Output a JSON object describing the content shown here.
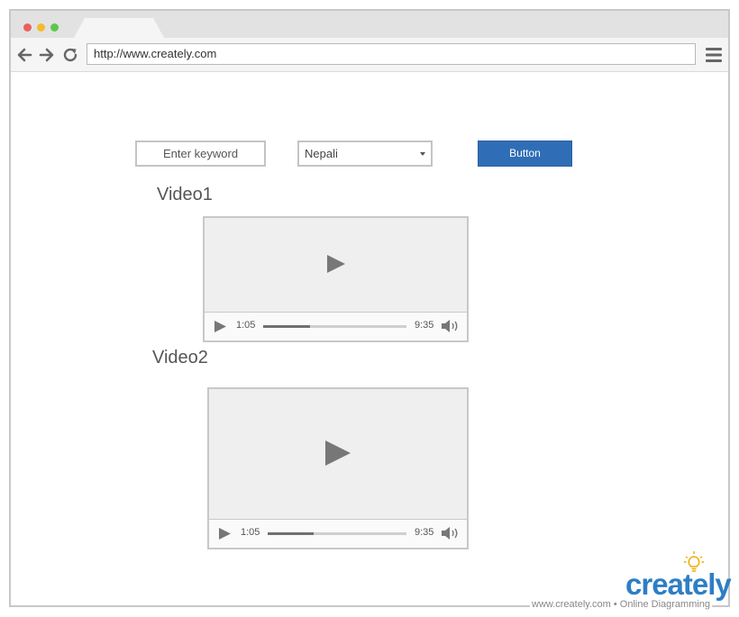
{
  "browser": {
    "url": "http://www.creately.com",
    "window_dots": [
      "#ec5f5a",
      "#f4bb2e",
      "#5ac84e"
    ]
  },
  "form": {
    "keyword_placeholder": "Enter keyword",
    "language_selected": "Nepali",
    "button_label": "Button",
    "button_color": "#2f6eb6"
  },
  "videos": [
    {
      "title": "Video1",
      "current_time": "1:05",
      "duration": "9:35",
      "progress": 0.33
    },
    {
      "title": "Video2",
      "current_time": "1:05",
      "duration": "9:35",
      "progress": 0.33
    }
  ],
  "watermark": {
    "brand": "creately",
    "footer": "www.creately.com • Online Diagramming"
  }
}
